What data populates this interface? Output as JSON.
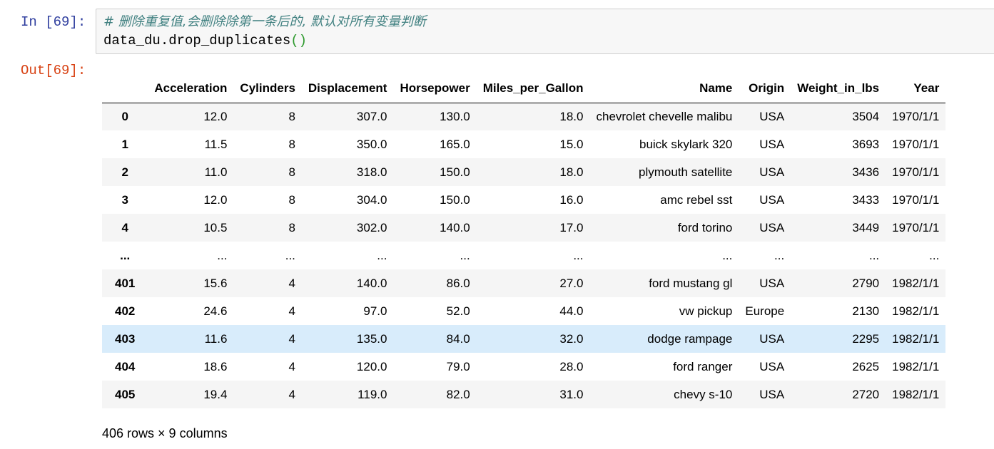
{
  "cell": {
    "in_prompt": "In [69]:",
    "out_prompt": "Out[69]:",
    "code_comment": "# 删除重复值,会删除除第一条后的, 默认对所有变量判断",
    "code_call_prefix": "data_du.drop_duplicates",
    "code_call_open": "(",
    "code_call_close": ")"
  },
  "table": {
    "columns": [
      "",
      "Acceleration",
      "Cylinders",
      "Displacement",
      "Horsepower",
      "Miles_per_Gallon",
      "Name",
      "Origin",
      "Weight_in_lbs",
      "Year"
    ],
    "rows": [
      {
        "index": "0",
        "cells": [
          "12.0",
          "8",
          "307.0",
          "130.0",
          "18.0",
          "chevrolet chevelle malibu",
          "USA",
          "3504",
          "1970/1/1"
        ]
      },
      {
        "index": "1",
        "cells": [
          "11.5",
          "8",
          "350.0",
          "165.0",
          "15.0",
          "buick skylark 320",
          "USA",
          "3693",
          "1970/1/1"
        ]
      },
      {
        "index": "2",
        "cells": [
          "11.0",
          "8",
          "318.0",
          "150.0",
          "18.0",
          "plymouth satellite",
          "USA",
          "3436",
          "1970/1/1"
        ]
      },
      {
        "index": "3",
        "cells": [
          "12.0",
          "8",
          "304.0",
          "150.0",
          "16.0",
          "amc rebel sst",
          "USA",
          "3433",
          "1970/1/1"
        ]
      },
      {
        "index": "4",
        "cells": [
          "10.5",
          "8",
          "302.0",
          "140.0",
          "17.0",
          "ford torino",
          "USA",
          "3449",
          "1970/1/1"
        ]
      },
      {
        "index": "...",
        "cells": [
          "...",
          "...",
          "...",
          "...",
          "...",
          "...",
          "...",
          "...",
          "..."
        ]
      },
      {
        "index": "401",
        "cells": [
          "15.6",
          "4",
          "140.0",
          "86.0",
          "27.0",
          "ford mustang gl",
          "USA",
          "2790",
          "1982/1/1"
        ]
      },
      {
        "index": "402",
        "cells": [
          "24.6",
          "4",
          "97.0",
          "52.0",
          "44.0",
          "vw pickup",
          "Europe",
          "2130",
          "1982/1/1"
        ]
      },
      {
        "index": "403",
        "cells": [
          "11.6",
          "4",
          "135.0",
          "84.0",
          "32.0",
          "dodge rampage",
          "USA",
          "2295",
          "1982/1/1"
        ],
        "highlighted": true
      },
      {
        "index": "404",
        "cells": [
          "18.6",
          "4",
          "120.0",
          "79.0",
          "28.0",
          "ford ranger",
          "USA",
          "2625",
          "1982/1/1"
        ]
      },
      {
        "index": "405",
        "cells": [
          "19.4",
          "4",
          "119.0",
          "82.0",
          "31.0",
          "chevy s-10",
          "USA",
          "2720",
          "1982/1/1"
        ]
      }
    ],
    "summary": "406 rows × 9 columns"
  },
  "colors": {
    "in_prompt": "#303f9f",
    "out_prompt": "#d84315",
    "comment": "#408080",
    "paren": "#2e9a2e",
    "row_stripe": "#f5f5f5",
    "row_hover": "#d8ecfb"
  }
}
